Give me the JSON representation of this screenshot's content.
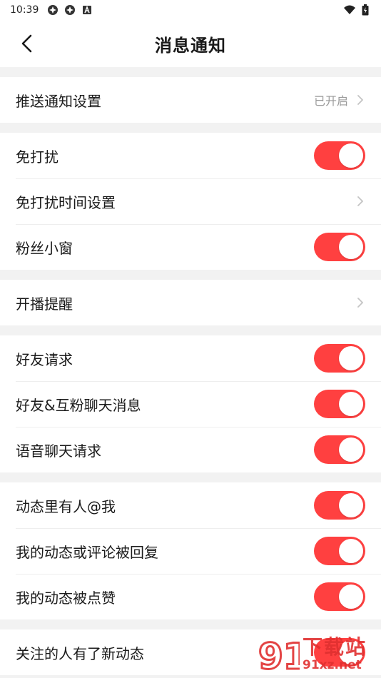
{
  "status_bar": {
    "time": "10:39"
  },
  "header": {
    "title": "消息通知"
  },
  "groups": [
    {
      "items": [
        {
          "label": "推送通知设置",
          "value": "已开启",
          "type": "link"
        }
      ]
    },
    {
      "items": [
        {
          "label": "免打扰",
          "type": "toggle",
          "on": true
        },
        {
          "label": "免打扰时间设置",
          "type": "link"
        },
        {
          "label": "粉丝小窗",
          "type": "toggle",
          "on": true
        }
      ]
    },
    {
      "items": [
        {
          "label": "开播提醒",
          "type": "link"
        }
      ]
    },
    {
      "items": [
        {
          "label": "好友请求",
          "type": "toggle",
          "on": true
        },
        {
          "label": "好友&互粉聊天消息",
          "type": "toggle",
          "on": true
        },
        {
          "label": "语音聊天请求",
          "type": "toggle",
          "on": true
        }
      ]
    },
    {
      "items": [
        {
          "label": "动态里有人@我",
          "type": "toggle",
          "on": true
        },
        {
          "label": "我的动态或评论被回复",
          "type": "toggle",
          "on": true
        },
        {
          "label": "我的动态被点赞",
          "type": "toggle",
          "on": true
        }
      ]
    },
    {
      "items": [
        {
          "label": "关注的人有了新动态",
          "type": "toggle",
          "on": true
        }
      ]
    }
  ],
  "watermark": {
    "cn": "下载站",
    "en": "91xz.net",
    "logo": "91"
  },
  "colors": {
    "accent": "#ff4040",
    "background": "#f2f2f2"
  }
}
